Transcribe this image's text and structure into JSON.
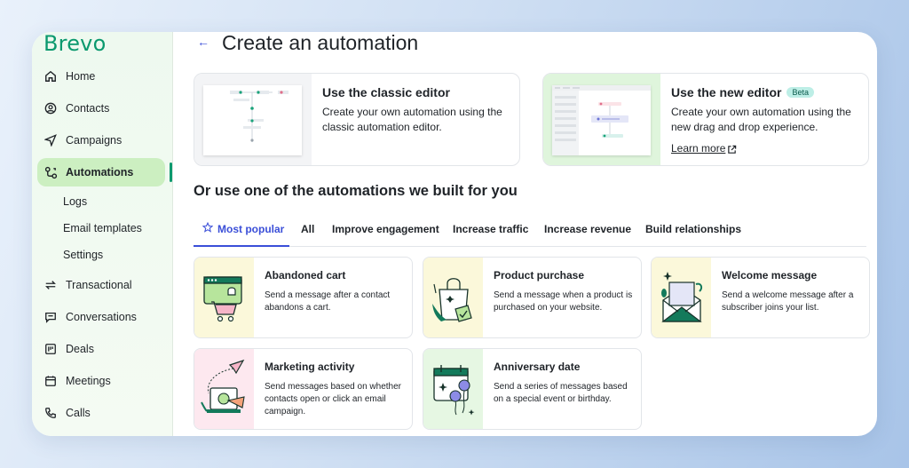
{
  "app": {
    "logo": "Brevo"
  },
  "sidebar": {
    "items": [
      {
        "label": "Home",
        "icon": "home-icon"
      },
      {
        "label": "Contacts",
        "icon": "contacts-icon"
      },
      {
        "label": "Campaigns",
        "icon": "send-icon"
      },
      {
        "label": "Automations",
        "icon": "automation-icon",
        "active": true
      },
      {
        "label": "Transactional",
        "icon": "transactional-icon"
      },
      {
        "label": "Conversations",
        "icon": "chat-icon"
      },
      {
        "label": "Deals",
        "icon": "deals-icon"
      },
      {
        "label": "Meetings",
        "icon": "calendar-icon"
      },
      {
        "label": "Calls",
        "icon": "phone-icon"
      }
    ],
    "sub_items": [
      "Logs",
      "Email templates",
      "Settings"
    ]
  },
  "header": {
    "title": "Create an automation"
  },
  "editors": {
    "classic": {
      "title": "Use the classic editor",
      "description": "Create your own automation using the classic automation editor."
    },
    "new": {
      "title": "Use the new editor",
      "badge": "Beta",
      "description": "Create your own automation using the new drag and drop experience.",
      "link": "Learn more"
    }
  },
  "section": {
    "title": "Or use one of the automations we built for you"
  },
  "tabs": [
    "Most popular",
    "All",
    "Improve engagement",
    "Increase traffic",
    "Increase revenue",
    "Build relationships"
  ],
  "templates": [
    {
      "title": "Abandoned cart",
      "description": "Send a message after a contact abandons a cart."
    },
    {
      "title": "Product purchase",
      "description": "Send a message when a product is purchased on your website."
    },
    {
      "title": "Welcome message",
      "description": "Send a welcome message after a subscriber joins your list."
    },
    {
      "title": "Marketing activity",
      "description": "Send messages based on whether contacts open or click an email campaign."
    },
    {
      "title": "Anniversary date",
      "description": "Send a series of messages based on a special event or birthday."
    }
  ],
  "colors": {
    "brand": "#0b996e",
    "accent": "#3b4fd8",
    "active_nav": "#ccefc1"
  }
}
